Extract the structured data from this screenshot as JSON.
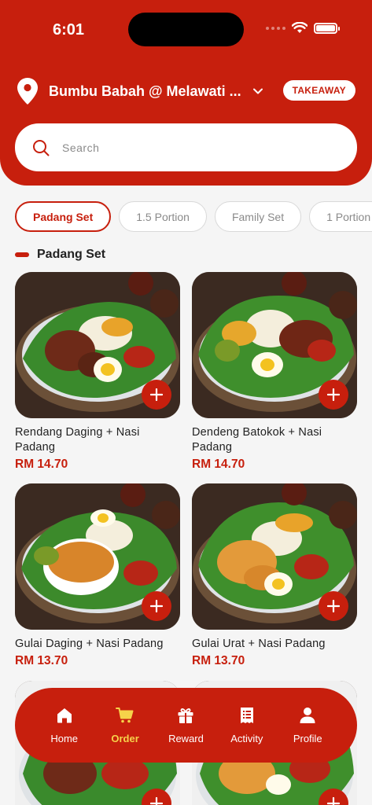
{
  "status": {
    "time": "6:01"
  },
  "header": {
    "store_name": "Bumbu Babah @ Melawati ...",
    "mode_badge": "TAKEAWAY"
  },
  "search": {
    "placeholder": "Search"
  },
  "tabs": [
    {
      "label": "Padang Set",
      "active": true
    },
    {
      "label": "1.5 Portion",
      "active": false
    },
    {
      "label": "Family Set",
      "active": false
    },
    {
      "label": "1 Portion",
      "active": false
    }
  ],
  "section": {
    "title": "Padang Set"
  },
  "products": [
    {
      "name": "Rendang Daging + Nasi Padang",
      "price": "RM 14.70"
    },
    {
      "name": "Dendeng Batokok + Nasi Padang",
      "price": "RM 14.70"
    },
    {
      "name": "Gulai Daging + Nasi Padang",
      "price": "RM 13.70"
    },
    {
      "name": "Gulai Urat + Nasi Padang",
      "price": "RM 13.70"
    }
  ],
  "nav": [
    {
      "label": "Home",
      "icon": "home-icon",
      "active": false
    },
    {
      "label": "Order",
      "icon": "cart-icon",
      "active": true
    },
    {
      "label": "Reward",
      "icon": "gift-icon",
      "active": false
    },
    {
      "label": "Activity",
      "icon": "receipt-icon",
      "active": false
    },
    {
      "label": "Profile",
      "icon": "person-icon",
      "active": false
    }
  ],
  "colors": {
    "brand": "#c71f0d",
    "active_nav": "#f6d24a"
  }
}
